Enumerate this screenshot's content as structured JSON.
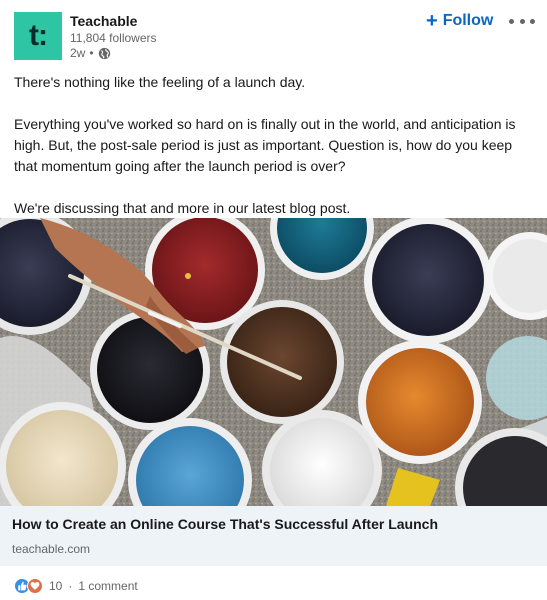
{
  "post": {
    "author": {
      "name": "Teachable",
      "followers": "11,804 followers",
      "time": "2w",
      "separator": "•",
      "logo_text": "t:",
      "logo_color": "#2ec5a4"
    },
    "follow_label": "Follow",
    "paragraphs": [
      "There's nothing like the feeling of a launch day.",
      "Everything you've worked so hard on is finally out in the world, and anticipation is high. But, the post-sale period is just as important. Question is, how do you keep that momentum going after the launch period is over?",
      "We're discussing that and more in our latest blog post."
    ],
    "link": {
      "title": "How to Create an Online Course That's Successful After Launch",
      "domain": "teachable.com"
    },
    "social": {
      "reaction_count": "10",
      "dot": "·",
      "comments": "1 comment",
      "reaction_icons": [
        "like-icon",
        "love-icon"
      ]
    }
  },
  "colors": {
    "link_blue": "#0a66c2",
    "card_bg": "#eef3f8",
    "muted": "#666666"
  }
}
